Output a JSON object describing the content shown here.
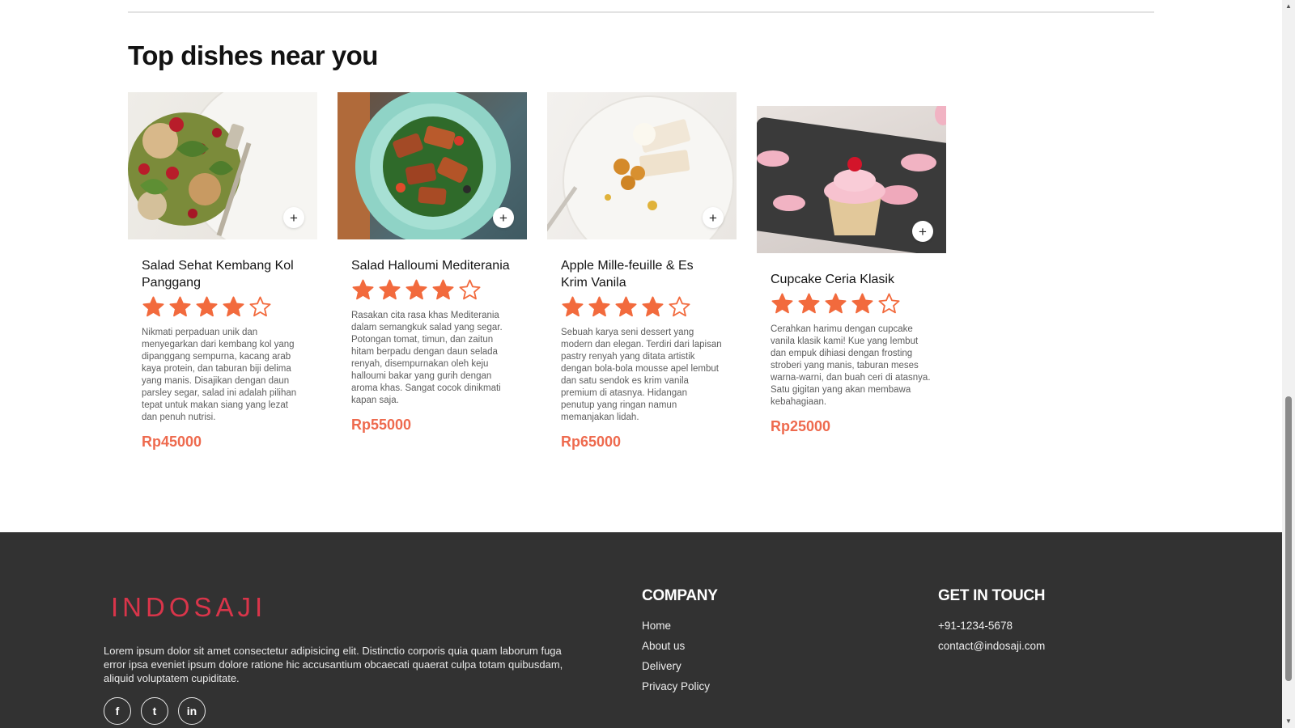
{
  "section": {
    "title": "Top dishes near you"
  },
  "colors": {
    "accent": "#ee6a4e",
    "star": "#f26a3d",
    "footer_bg": "#323232",
    "brand": "#d9354a"
  },
  "dishes": [
    {
      "name": "Salad Sehat Kembang Kol Panggang",
      "rating": 4,
      "max_rating": 5,
      "description": "Nikmati perpaduan unik dan menyegarkan dari kembang kol yang dipanggang sempurna, kacang arab kaya protein, dan taburan biji delima yang manis. Disajikan dengan daun parsley segar, salad ini adalah pilihan tepat untuk makan siang yang lezat dan penuh nutrisi.",
      "price": "Rp45000",
      "add_icon": "plus-icon"
    },
    {
      "name": "Salad Halloumi Mediterania",
      "rating": 4,
      "max_rating": 5,
      "description": "Rasakan cita rasa khas Mediterania dalam semangkuk salad yang segar. Potongan tomat, timun, dan zaitun hitam berpadu dengan daun selada renyah, disempurnakan oleh keju halloumi bakar yang gurih dengan aroma khas. Sangat cocok dinikmati kapan saja.",
      "price": "Rp55000",
      "add_icon": "plus-icon"
    },
    {
      "name": "Apple Mille-feuille & Es Krim Vanila",
      "rating": 4,
      "max_rating": 5,
      "description": "Sebuah karya seni dessert yang modern dan elegan. Terdiri dari lapisan pastry renyah yang ditata artistik dengan bola-bola mousse apel lembut dan satu sendok es krim vanila premium di atasnya. Hidangan penutup yang ringan namun memanjakan lidah.",
      "price": "Rp65000",
      "add_icon": "plus-icon"
    },
    {
      "name": "Cupcake Ceria Klasik",
      "rating": 4,
      "max_rating": 5,
      "description": "Cerahkan harimu dengan cupcake vanila klasik kami! Kue yang lembut dan empuk dihiasi dengan frosting stroberi yang manis, taburan meses warna-warni, dan buah ceri di atasnya. Satu gigitan yang akan membawa kebahagiaan.",
      "price": "Rp25000",
      "add_icon": "plus-icon"
    }
  ],
  "footer": {
    "logo": "INDOSAJI",
    "text": "Lorem ipsum dolor sit amet consectetur adipisicing elit. Distinctio corporis quia quam laborum fuga error ipsa eveniet ipsum dolore ratione hic accusantium obcaecati quaerat culpa totam quibusdam, aliquid voluptatem cupiditate.",
    "socials": [
      {
        "icon": "facebook-icon",
        "glyph": "f"
      },
      {
        "icon": "twitter-icon",
        "glyph": "t"
      },
      {
        "icon": "linkedin-icon",
        "glyph": "in"
      }
    ],
    "company": {
      "heading": "COMPANY",
      "links": [
        "Home",
        "About us",
        "Delivery",
        "Privacy Policy"
      ]
    },
    "contact": {
      "heading": "GET IN TOUCH",
      "phone": "+91-1234-5678",
      "email": "contact@indosaji.com"
    }
  }
}
